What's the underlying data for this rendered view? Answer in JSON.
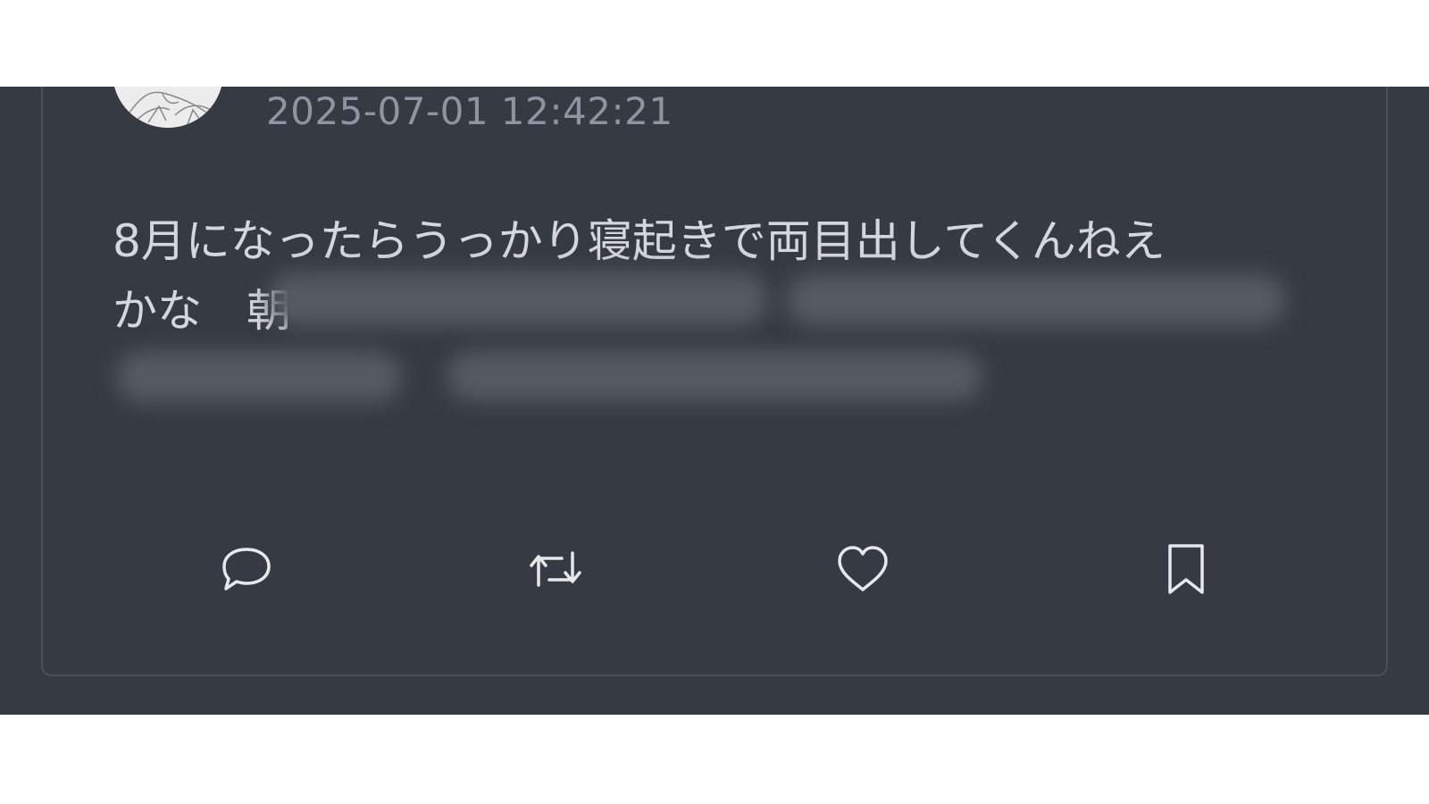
{
  "post": {
    "timestamp": "2025-07-01 12:42:21",
    "text_line_1": "8月になったらうっかり寝起きで両目出してくんねえ",
    "text_line_2": "かな　朝"
  },
  "actions": {
    "reply_icon": "speech-bubble",
    "repost_icon": "repost-arrows",
    "like_icon": "heart",
    "bookmark_icon": "bookmark"
  },
  "colors": {
    "background": "#363a42",
    "text": "#d4d7dd",
    "muted_text": "#8e95a0",
    "icon": "#e6e8ec"
  }
}
